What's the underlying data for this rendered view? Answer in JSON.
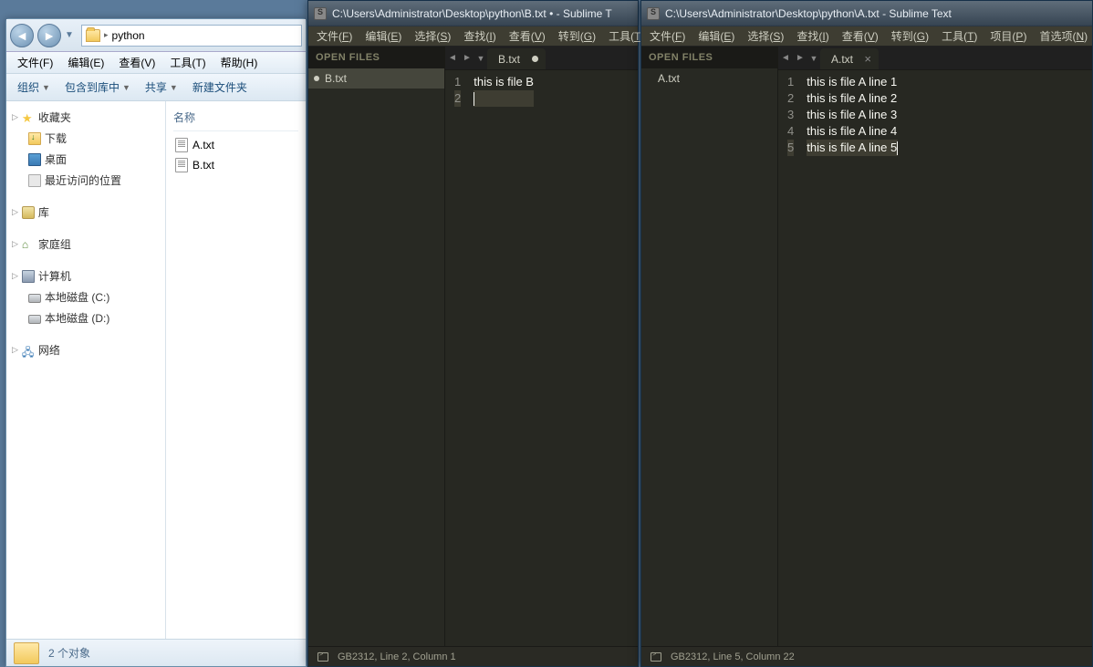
{
  "explorer": {
    "addr_folder": "python",
    "menu": [
      "文件(F)",
      "编辑(E)",
      "查看(V)",
      "工具(T)",
      "帮助(H)"
    ],
    "toolbar": {
      "org": "组织",
      "inc": "包含到库中",
      "share": "共享",
      "new": "新建文件夹"
    },
    "tree": {
      "fav": "收藏夹",
      "downloads": "下载",
      "desktop": "桌面",
      "recent": "最近访问的位置",
      "lib": "库",
      "home": "家庭组",
      "pc": "计算机",
      "diskC": "本地磁盘 (C:)",
      "diskD": "本地磁盘 (D:)",
      "net": "网络"
    },
    "col_name": "名称",
    "files": [
      "A.txt",
      "B.txt"
    ],
    "status": "2 个对象"
  },
  "sublime1": {
    "title": "C:\\Users\\Administrator\\Desktop\\python\\B.txt • - Sublime T",
    "menu": [
      [
        "文件",
        "F"
      ],
      [
        "编辑",
        "E"
      ],
      [
        "选择",
        "S"
      ],
      [
        "查找",
        "I"
      ],
      [
        "查看",
        "V"
      ],
      [
        "转到",
        "G"
      ],
      [
        "工具",
        "T"
      ]
    ],
    "open_files": "OPEN FILES",
    "open_item": "B.txt",
    "tab": "B.txt",
    "lines": [
      "this is file B",
      ""
    ],
    "cur_line": 2,
    "status": "GB2312, Line 2, Column 1"
  },
  "sublime2": {
    "title": "C:\\Users\\Administrator\\Desktop\\python\\A.txt - Sublime Text",
    "menu": [
      [
        "文件",
        "F"
      ],
      [
        "编辑",
        "E"
      ],
      [
        "选择",
        "S"
      ],
      [
        "查找",
        "I"
      ],
      [
        "查看",
        "V"
      ],
      [
        "转到",
        "G"
      ],
      [
        "工具",
        "T"
      ],
      [
        "项目",
        "P"
      ],
      [
        "首选项",
        "N"
      ]
    ],
    "open_files": "OPEN FILES",
    "open_item": "A.txt",
    "tab": "A.txt",
    "lines": [
      "this is file A line 1",
      "this is file A line 2",
      "this is file A line 3",
      "this is file A line 4",
      "this is file A line 5"
    ],
    "cur_line": 5,
    "status": "GB2312, Line 5, Column 22"
  }
}
